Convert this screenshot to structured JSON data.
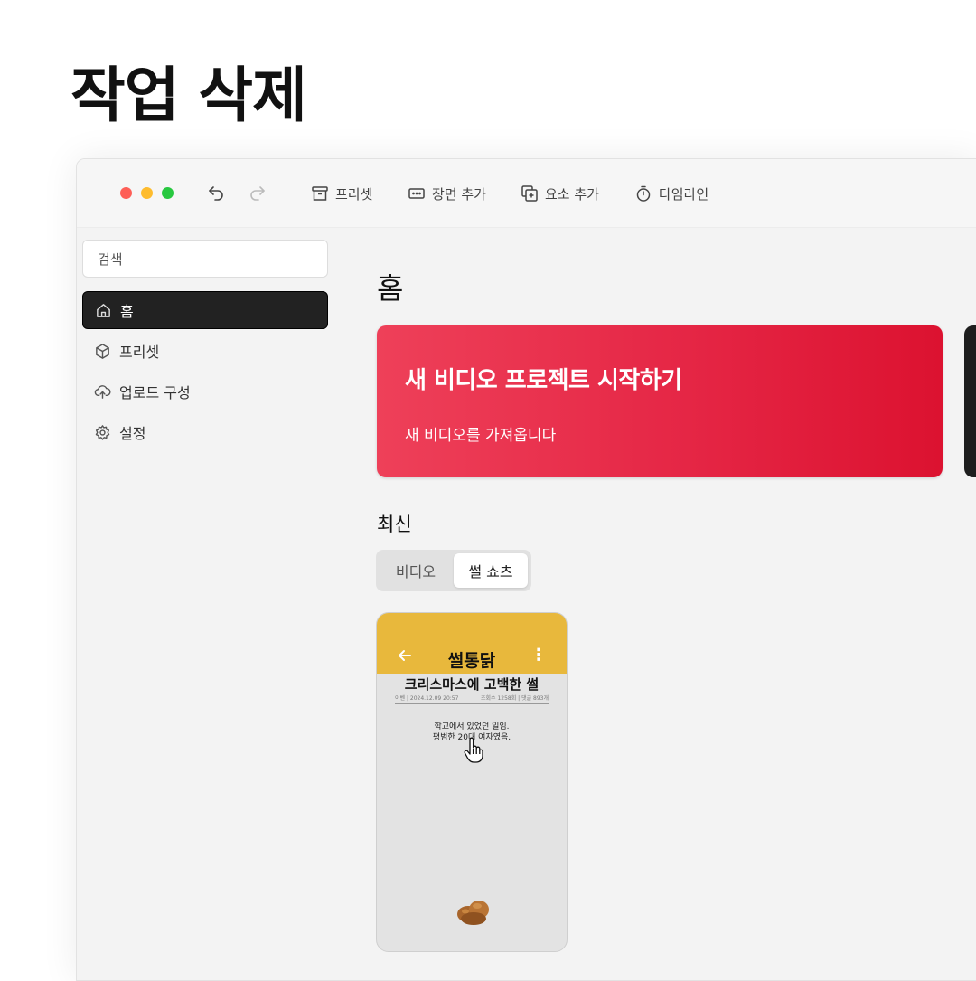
{
  "page": {
    "heading": "작업 삭제"
  },
  "toolbar": {
    "items": [
      {
        "label": "프리셋",
        "icon": "archive-box-icon"
      },
      {
        "label": "장면 추가",
        "icon": "scene-add-icon"
      },
      {
        "label": "요소 추가",
        "icon": "element-add-icon"
      },
      {
        "label": "타임라인",
        "icon": "stopwatch-icon"
      }
    ]
  },
  "sidebar": {
    "search_placeholder": "검색",
    "items": [
      {
        "label": "홈",
        "icon": "home-icon",
        "active": true
      },
      {
        "label": "프리셋",
        "icon": "cube-icon"
      },
      {
        "label": "업로드 구성",
        "icon": "cloud-upload-icon"
      },
      {
        "label": "설정",
        "icon": "gear-icon"
      }
    ]
  },
  "main": {
    "title": "홈",
    "hero": {
      "title": "새 비디오 프로젝트 시작하기",
      "subtitle": "새 비디오를 가져옵니다"
    },
    "recent": {
      "title": "최신",
      "tabs": [
        {
          "label": "비디오"
        },
        {
          "label": "썰 쇼츠",
          "selected": true
        }
      ]
    },
    "thumbnail": {
      "logo": "썰통닭",
      "post_title": "크리스마스에 고백한 썰",
      "meta_left": "이벤 | 2024.12.09 20:57",
      "meta_right": "조회수 1258회 | 댓글 893개",
      "body_line1": "학교에서 있었던 일임.",
      "body_line2": "평범한 20대 여자였음."
    }
  },
  "colors": {
    "accent": "#e52645",
    "thumb_bar": "#e8b83c",
    "active_nav": "#222222"
  }
}
